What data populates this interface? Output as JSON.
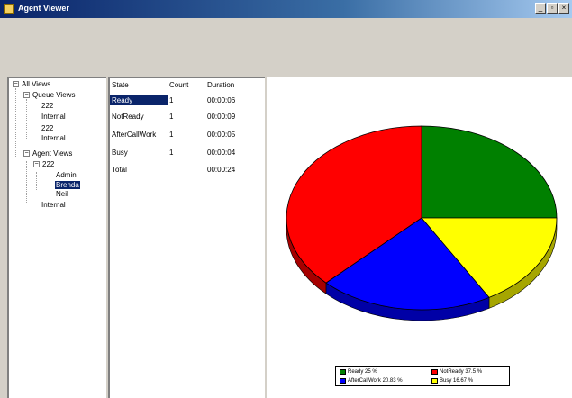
{
  "window": {
    "title": "Agent Viewer",
    "buttons": [
      "_",
      "▫",
      "×"
    ]
  },
  "tree": {
    "root": "All Views",
    "queue_views": {
      "label": "Queue Views",
      "children": [
        "222",
        "Internal",
        "222",
        "Internal"
      ]
    },
    "agent_views": {
      "label": "Agent Views",
      "group": "222",
      "agents": [
        "Admin",
        "Brenda",
        "Neil"
      ],
      "tail": "Internal"
    },
    "selected": "Brenda"
  },
  "grid": {
    "headers": [
      "State",
      "Count",
      "Duration"
    ],
    "rows": [
      {
        "state": "Ready",
        "count": "1",
        "duration": "00:00:06"
      },
      {
        "state": "NotReady",
        "count": "1",
        "duration": "00:00:09"
      },
      {
        "state": "AfterCallWork",
        "count": "1",
        "duration": "00:00:05"
      },
      {
        "state": "Busy",
        "count": "1",
        "duration": "00:00:04"
      },
      {
        "state": "Total",
        "count": "",
        "duration": "00:00:24"
      }
    ]
  },
  "chart_data": {
    "type": "pie",
    "slices": [
      {
        "label": "Ready 25 %",
        "value": 25.0,
        "color": "#008000"
      },
      {
        "label": "AfterCallWork 20.83 %",
        "value": 20.83,
        "color": "#0000ff"
      },
      {
        "label": "NotReady 37.5 %",
        "value": 37.5,
        "color": "#ff0000"
      },
      {
        "label": "Busy 16.67 %",
        "value": 16.67,
        "color": "#ffff00"
      }
    ],
    "draw_order": [
      0,
      3,
      1,
      2
    ],
    "legend": "bottom-center"
  }
}
